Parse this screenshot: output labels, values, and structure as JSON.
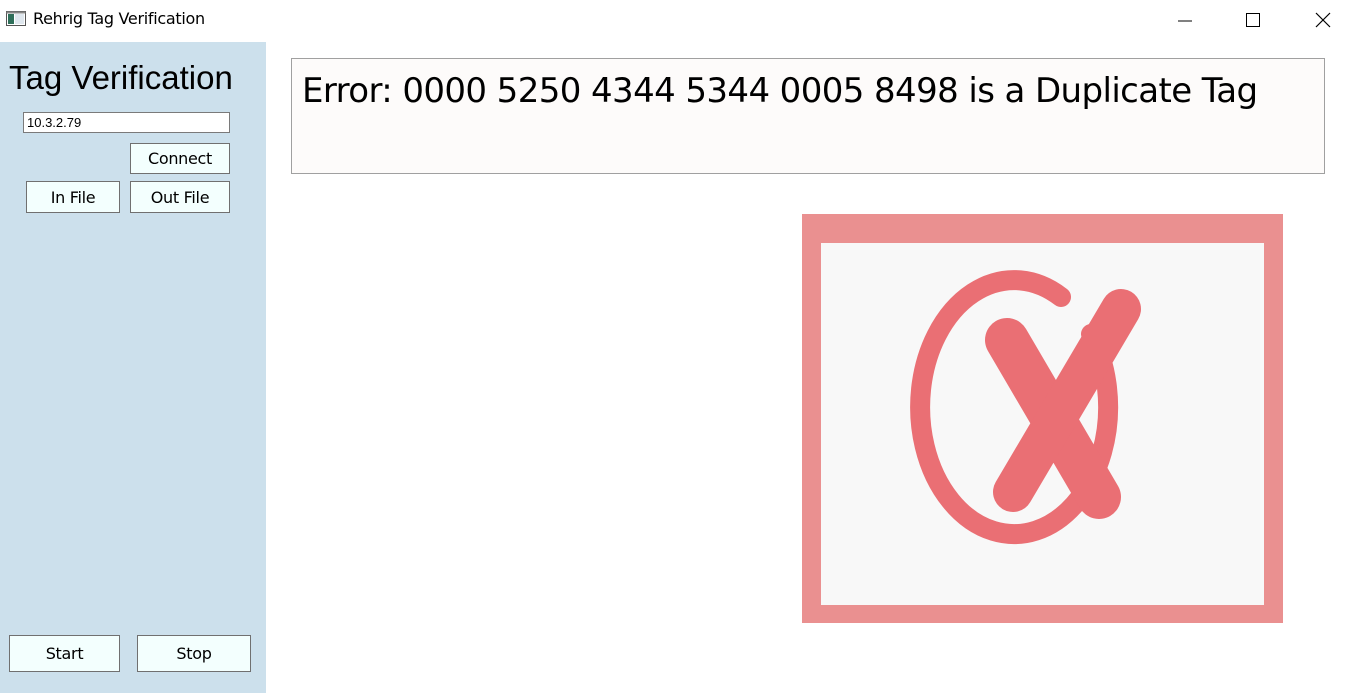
{
  "window": {
    "title": "Rehrig Tag Verification",
    "controls": [
      "minimize-icon",
      "maximize-icon",
      "close-icon"
    ]
  },
  "sidebar": {
    "title": "Tag Verification",
    "ip_address": "10.3.2.79",
    "connect_label": "Connect",
    "in_file_label": "In File",
    "out_file_label": "Out File",
    "start_label": "Start",
    "stop_label": "Stop"
  },
  "main": {
    "message": "Error: 0000 5250 4344 5344 0005 8498 is a Duplicate Tag",
    "status_icon": "error-x-circle-icon"
  },
  "colors": {
    "sidebar_bg": "#cce0ec",
    "button_bg": "#f3fffe",
    "error_frame": "#ea9090",
    "error_mark": "#ea6f74"
  }
}
